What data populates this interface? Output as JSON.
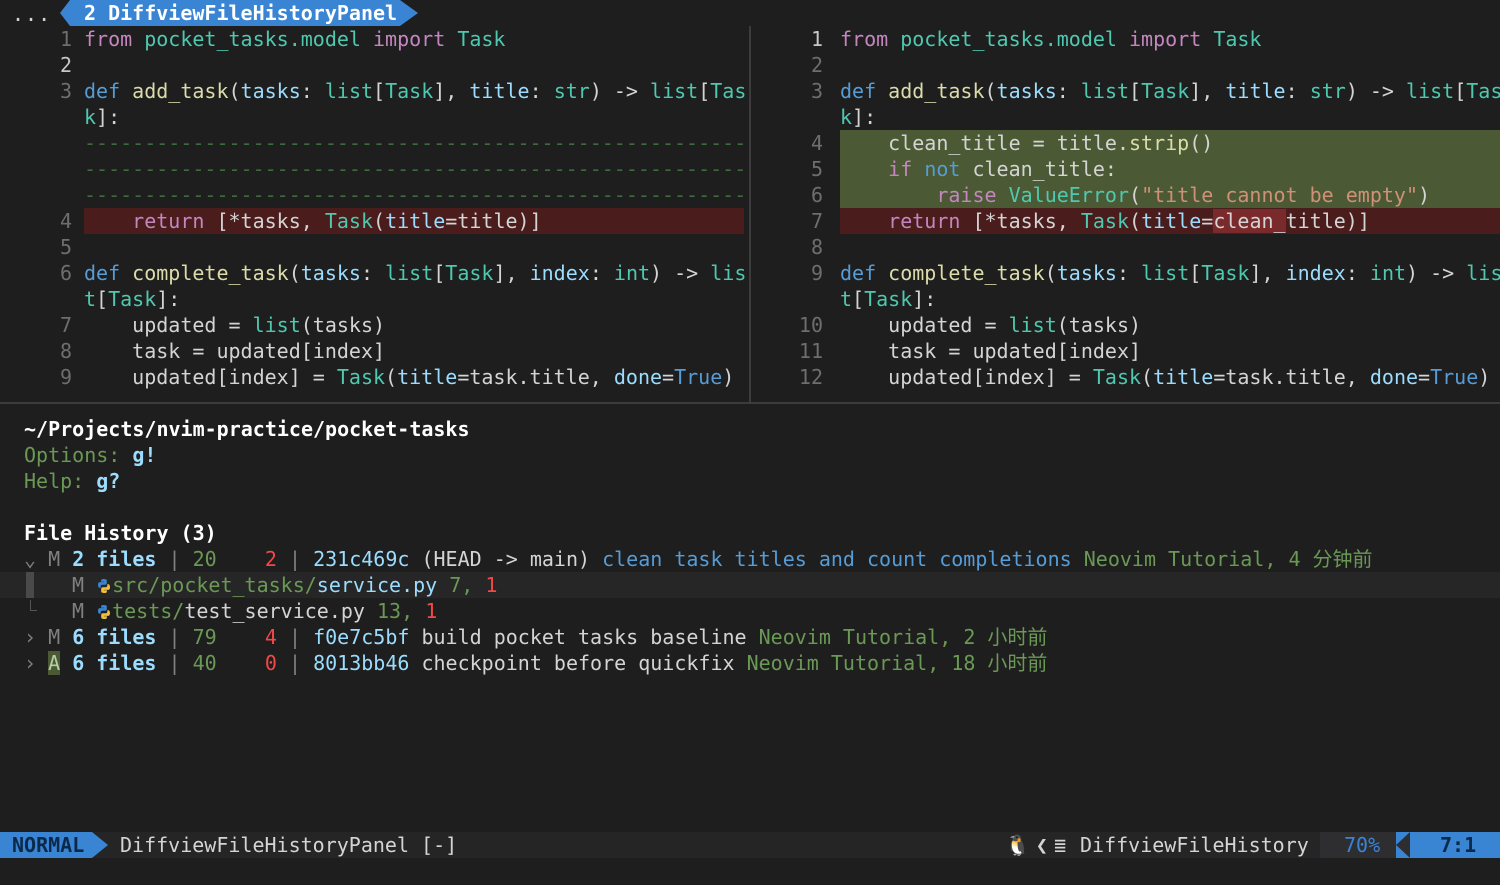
{
  "tabline": {
    "dots": "...",
    "active_tab": "2 DiffviewFileHistoryPanel"
  },
  "left_pane": {
    "lines": [
      {
        "n": "1",
        "t": "from pocket_tasks.model import Task"
      },
      {
        "n": "2",
        "t": ""
      },
      {
        "n": "3",
        "t": "def add_task(tasks: list[Task], title: str) -> list[Tas"
      },
      {
        "n": "",
        "t": "k]:"
      },
      {
        "n": "",
        "t": "------------------------------------------------------------"
      },
      {
        "n": "",
        "t": "------------------------------------------------------------"
      },
      {
        "n": "",
        "t": "------------------------------------------------------------"
      },
      {
        "n": "4",
        "t": "    return [*tasks, Task(title=title)]"
      },
      {
        "n": "5",
        "t": ""
      },
      {
        "n": "6",
        "t": "def complete_task(tasks: list[Task], index: int) -> lis"
      },
      {
        "n": "",
        "t": "t[Task]:"
      },
      {
        "n": "7",
        "t": "    updated = list(tasks)"
      },
      {
        "n": "8",
        "t": "    task = updated[index]"
      },
      {
        "n": "9",
        "t": "    updated[index] = Task(title=task.title, done=True)"
      }
    ]
  },
  "right_pane": {
    "lines": [
      {
        "n": "1",
        "t": "from pocket_tasks.model import Task"
      },
      {
        "n": "2",
        "t": ""
      },
      {
        "n": "3",
        "t": "def add_task(tasks: list[Task], title: str) -> list[Tas"
      },
      {
        "n": "",
        "t": "k]:"
      },
      {
        "n": "4",
        "t": "    clean_title = title.strip()"
      },
      {
        "n": "5",
        "t": "    if not clean_title:"
      },
      {
        "n": "6",
        "t": "        raise ValueError(\"title cannot be empty\")"
      },
      {
        "n": "7",
        "t": "    return [*tasks, Task(title=clean_title)]"
      },
      {
        "n": "8",
        "t": ""
      },
      {
        "n": "9",
        "t": "def complete_task(tasks: list[Task], index: int) -> lis"
      },
      {
        "n": "",
        "t": "t[Task]:"
      },
      {
        "n": "10",
        "t": "    updated = list(tasks)"
      },
      {
        "n": "11",
        "t": "    task = updated[index]"
      },
      {
        "n": "12",
        "t": "    updated[index] = Task(title=task.title, done=True)"
      }
    ]
  },
  "panel": {
    "path": "~/Projects/nvim-practice/pocket-tasks",
    "options_label": "Options:",
    "options_key": "g!",
    "help_label": "Help:",
    "help_key": "g?",
    "history_title": "File History (3)",
    "commits": [
      {
        "fold": "⌄",
        "status": "M",
        "files": "2 files",
        "adds": "20",
        "dels": "2",
        "hash": "231c469c",
        "refs": "(HEAD -> main)",
        "subject": "clean task titles and count completions",
        "author": "Neovim Tutorial,",
        "age": "4 分钟前"
      },
      {
        "fold": "›",
        "status": "M",
        "files": "6 files",
        "adds": "79",
        "dels": "4",
        "hash": "f0e7c5bf",
        "refs": "",
        "subject": "build pocket tasks baseline",
        "author": "Neovim Tutorial,",
        "age": "2 小时前"
      },
      {
        "fold": "›",
        "status": "A",
        "files": "6 files",
        "adds": "40",
        "dels": "0",
        "hash": "8013bb46",
        "refs": "",
        "subject": "checkpoint before quickfix",
        "author": "Neovim Tutorial,",
        "age": "18 小时前"
      }
    ],
    "files": [
      {
        "status": "M",
        "dir": "src/pocket_tasks/",
        "name": "service.py",
        "adds": "7,",
        "dels": "1"
      },
      {
        "status": "M",
        "dir": "tests/",
        "name": "test_service.py",
        "adds": "13,",
        "dels": "1"
      }
    ],
    "separator": "|"
  },
  "statusline": {
    "mode": "NORMAL",
    "file": "DiffviewFileHistoryPanel [-]",
    "filetype": "DiffviewFileHistory",
    "percent": "70%",
    "position": "7:1"
  },
  "colors": {
    "accent": "#3a84d4",
    "deleted_line": "#4a1c1c",
    "added_line": "#4b5a34",
    "changed_text": "#7a2a2a"
  }
}
